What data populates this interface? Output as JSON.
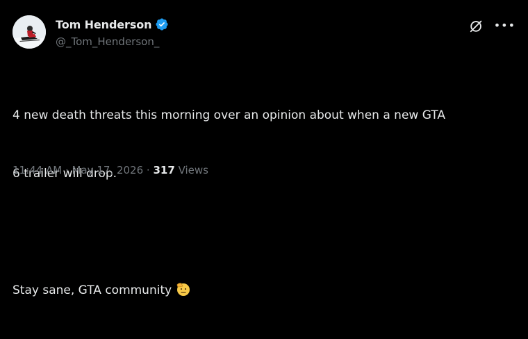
{
  "author": {
    "display_name": "Tom Henderson",
    "handle": "@_Tom_Henderson_",
    "verified": true
  },
  "icons": {
    "verified": "verified-badge-icon",
    "grok": "grok-icon",
    "more": "more-options-icon",
    "emoji": "saluting-face-emoji"
  },
  "tweet": {
    "line1": "4 new death threats this morning over an opinion about when a new GTA",
    "line2": "6 trailer will drop.",
    "line3": "Stay sane, GTA community"
  },
  "meta": {
    "time": "11:44 AM",
    "date": "May 17, 2026",
    "separator": "·",
    "views_count": "317",
    "views_label": "Views"
  },
  "colors": {
    "background": "#000000",
    "text": "#e7e9ea",
    "secondary": "#71767b",
    "verified": "#1d9bf0"
  }
}
